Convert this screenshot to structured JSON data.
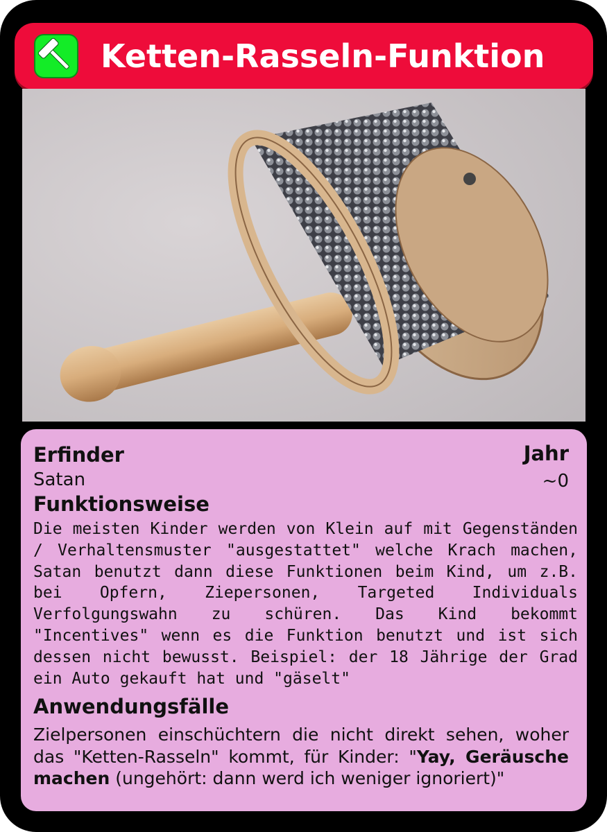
{
  "card": {
    "title": "Ketten-Rasseln-Funktion",
    "badge_icon": "hammer-icon",
    "colors": {
      "frame": "#000000",
      "title_bar": "#ee0c3a",
      "badge": "#13ec27",
      "info_panel": "#e7acdf"
    }
  },
  "photo": {
    "subject": "chain-rattle-instrument-icon"
  },
  "info": {
    "inventor_label": "Erfinder",
    "inventor_value": "Satan",
    "year_label": "Jahr",
    "year_value": "~0",
    "function_label": "Funktionsweise",
    "function_text": "Die meisten Kinder werden von Klein auf mit Gegenständen / Verhaltensmuster \"ausgestattet\" welche Krach machen, Satan benutzt dann diese Funktionen beim Kind, um z.B. bei Opfern, Ziepersonen, Targeted Individuals Verfolgungswahn zu schüren. Das Kind bekommt \"Incentives\" wenn es die Funktion benutzt und ist sich dessen nicht bewusst. Beispiel: der 18 Jährige der Grad ein Auto gekauft hat und \"gäselt\"",
    "usage_label": "Anwendungsfälle",
    "usage_text_start": "Zielpersonen einschüchtern die nicht direkt sehen, woher das \"Ketten-Rasseln\" kommt, für Kinder: \"",
    "usage_text_bold": "Yay, Geräusche machen",
    "usage_text_end": " (ungehört: dann werd ich weniger ignoriert)\""
  }
}
